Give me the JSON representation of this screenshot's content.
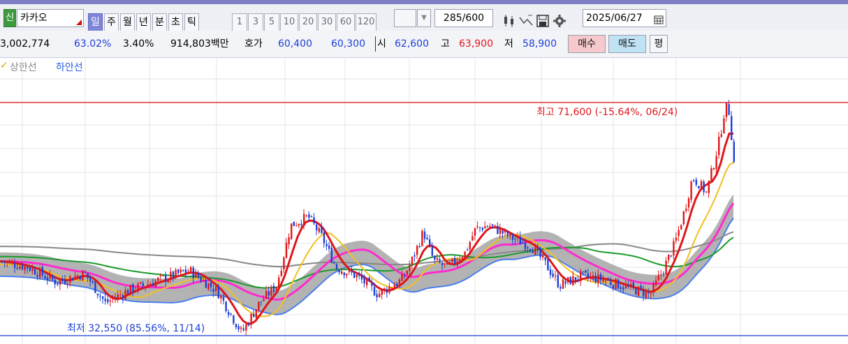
{
  "toolbar": {
    "new_badge": "신",
    "stock_name": "카카오",
    "period_tabs": [
      {
        "label": "일",
        "selected": true
      },
      {
        "label": "주",
        "selected": false
      },
      {
        "label": "월",
        "selected": false
      },
      {
        "label": "년",
        "selected": false
      },
      {
        "label": "분",
        "selected": false
      },
      {
        "label": "초",
        "selected": false
      },
      {
        "label": "틱",
        "selected": false
      }
    ],
    "minute_tabs": [
      "1",
      "3",
      "5",
      "10",
      "20",
      "30",
      "60",
      "120"
    ],
    "count_value": "285",
    "count_total": "/600",
    "date": "2025/06/27"
  },
  "info": {
    "volume": "3,002,774",
    "ratio1": "63.02%",
    "ratio2": "3.40%",
    "amount": "914,803백만",
    "ask_label": "호가",
    "ask1": "60,400",
    "ask2": "60,300",
    "open_label": "시",
    "open": "62,600",
    "high_label": "고",
    "high": "63,900",
    "low_label": "저",
    "low": "58,900",
    "buy_label": "매수",
    "sell_label": "매도",
    "eval_label": "평"
  },
  "legend": {
    "upper": "상한선",
    "lower": "하안선"
  },
  "chart_labels": {
    "max_label": "최고 71,600 (-15.64%, 06/24)",
    "min_label": "최저 32,550 (85.56%, 11/14)"
  },
  "colors": {
    "up_candle": "#e0161a",
    "down_candle": "#1c3fd6",
    "ma5": "#e0161a",
    "ma20": "#f0c020",
    "ma60": "#ff2ad0",
    "ma120": "#1a9a2a",
    "ma240": "#888888",
    "band": "#9a9a9a",
    "band_lower": "#4a7ef0"
  },
  "icons": [
    "dropdown-icon",
    "candle-config-icon",
    "trend-line-icon",
    "save-icon",
    "settings-gear-icon",
    "calendar-icon"
  ],
  "chart_data": {
    "type": "candlestick",
    "max_price": 71600,
    "max_change": "-15.64%",
    "max_date": "06/24",
    "min_price": 32550,
    "min_change": "85.56%",
    "min_date": "11/14",
    "bars": 285
  }
}
